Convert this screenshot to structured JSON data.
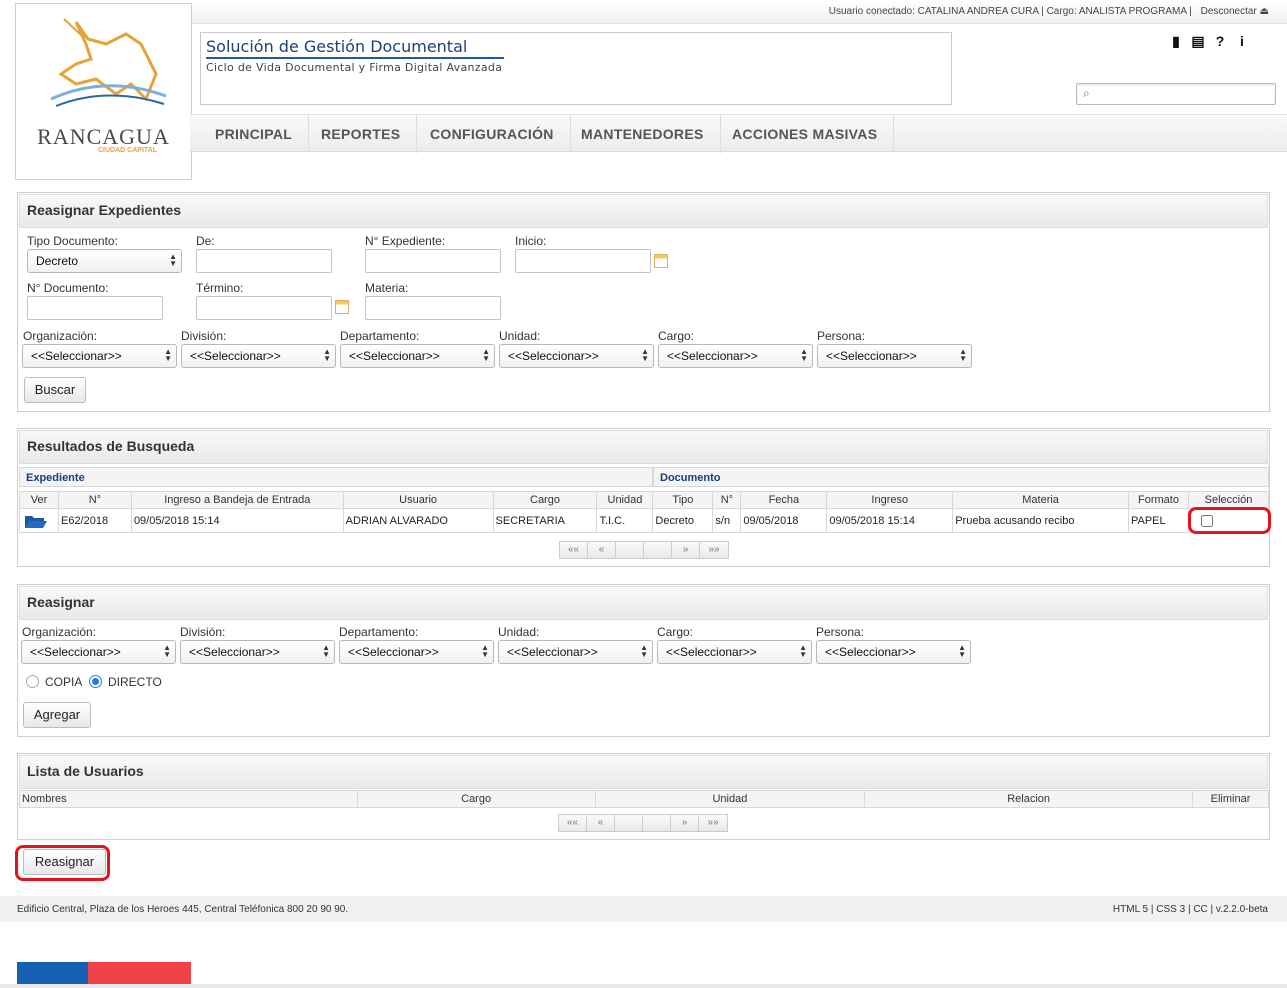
{
  "header": {
    "user_info": "Usuario conectado: CATALINA ANDREA CURA | Cargo: ANALISTA PROGRAMA |",
    "logout": "Desconectar ⏏",
    "app_title": "Solución de Gestión Documental",
    "app_subtitle": "Ciclo de Vida Documental y Firma Digital Avanzada",
    "logo_city": "RANCAGUA",
    "logo_sub": "CIUDAD CAPITAL",
    "icons": [
      "book-icon",
      "news-icon",
      "help-icon",
      "info-icon"
    ],
    "icon_glyphs": [
      "▮",
      "▤",
      "?",
      "i"
    ]
  },
  "nav": [
    "PRINCIPAL",
    "REPORTES",
    "CONFIGURACIÓN",
    "MANTENEDORES",
    "ACCIONES MASIVAS"
  ],
  "reasignar_expedientes": {
    "title": "Reasignar Expedientes",
    "labels": {
      "tipo_documento": "Tipo Documento:",
      "de": "De:",
      "n_expediente": "N° Expediente:",
      "inicio": "Inicio:",
      "n_documento": "N° Documento:",
      "termino": "Término:",
      "materia": "Materia:",
      "organizacion": "Organización:",
      "division": "División:",
      "departamento": "Departamento:",
      "unidad": "Unidad:",
      "cargo": "Cargo:",
      "persona": "Persona:"
    },
    "tipo_documento_value": "Decreto",
    "select_default": "<<Seleccionar>>",
    "buscar": "Buscar"
  },
  "resultados": {
    "title": "Resultados de Busqueda",
    "group_expediente": "Expediente",
    "group_documento": "Documento",
    "columns": [
      "Ver",
      "N°",
      "Ingreso a Bandeja de Entrada",
      "Usuario",
      "Cargo",
      "Unidad",
      "Tipo",
      "N°",
      "Fecha",
      "Ingreso",
      "Materia",
      "Formato",
      "Selección"
    ],
    "rows": [
      [
        "",
        "E62/2018",
        "09/05/2018 15:14",
        "ADRIAN ALVARADO",
        "SECRETARIA",
        "T.I.C.",
        "Decreto",
        "s/n",
        "09/05/2018",
        "09/05/2018 15:14",
        "Prueba acusando recibo",
        "PAPEL",
        ""
      ]
    ],
    "pager": [
      "««",
      "«",
      "",
      "",
      "»",
      "»»"
    ]
  },
  "reasignar": {
    "title": "Reasignar",
    "labels": {
      "organizacion": "Organización:",
      "division": "División:",
      "departamento": "Departamento:",
      "unidad": "Unidad:",
      "cargo": "Cargo:",
      "persona": "Persona:"
    },
    "select_default": "<<Seleccionar>>",
    "radio_copia": "COPIA",
    "radio_directo": "DIRECTO",
    "agregar": "Agregar"
  },
  "lista_usuarios": {
    "title": "Lista de Usuarios",
    "columns": [
      "Nombres",
      "Cargo",
      "Unidad",
      "Relacion",
      "Eliminar"
    ],
    "pager": [
      "««",
      "«",
      "",
      "",
      "»",
      "»»"
    ]
  },
  "reasignar_button": "Reasignar",
  "footer": {
    "address": "Edificio Central, Plaza de los Heroes 445, Central Teléfonica 800 20 90 90.",
    "tech": "HTML 5 | CSS 3 | CC | v.2.2.0-beta"
  },
  "colors": {
    "brand_blue": "#1f3f7a",
    "highlight_red": "#e3141c",
    "flag_blue": "#1560b3",
    "flag_red": "#ef4246"
  }
}
